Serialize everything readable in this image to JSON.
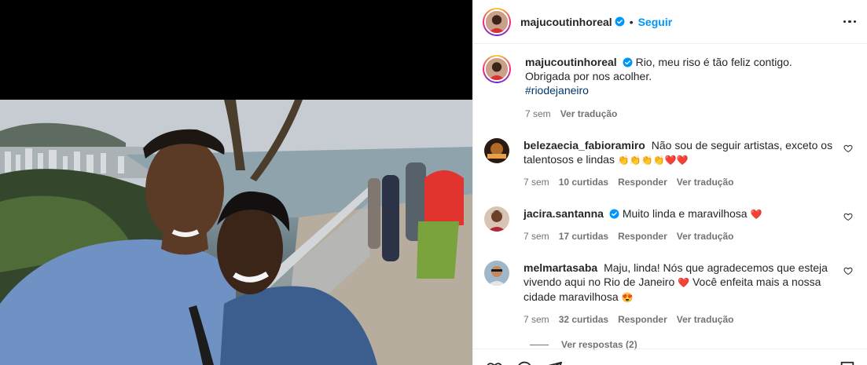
{
  "post": {
    "author": "majucoutinhoreal",
    "follow_label": "Seguir",
    "separator": "•"
  },
  "caption": {
    "author": "majucoutinhoreal",
    "line1": "Rio, meu riso é tão feliz contigo.",
    "line2": "Obrigada por nos acolher.",
    "hashtag": "#riodejaneiro",
    "time": "7 sem",
    "translate": "Ver tradução"
  },
  "comments": [
    {
      "author": "belezaecia_fabioramiro",
      "text": "Não sou de seguir artistas, exceto os talentosos e lindas",
      "emojis": "👏👏👏👏❤️❤️",
      "time": "7 sem",
      "likes": "10 curtidas",
      "reply": "Responder",
      "translate": "Ver tradução"
    },
    {
      "author": "jacira.santanna",
      "text": "Muito linda e maravilhosa",
      "emojis": "❤️",
      "time": "7 sem",
      "likes": "17 curtidas",
      "reply": "Responder",
      "translate": "Ver tradução"
    },
    {
      "author": "melmartasaba",
      "text_a": "Maju, linda! Nós que agradecemos que esteja vivendo aqui no Rio de Janeiro",
      "text_b": "Você enfeita mais a nossa cidade maravilhosa",
      "emoji_a": "❤️",
      "emoji_b": "😍",
      "time": "7 sem",
      "likes": "32 curtidas",
      "reply": "Responder",
      "translate": "Ver tradução",
      "replies": "Ver respostas (2)"
    }
  ],
  "icons": {
    "verified": "verified-badge-icon",
    "more": "more-options-icon",
    "like": "heart-icon",
    "comment": "comment-icon",
    "share": "share-icon",
    "save": "bookmark-icon"
  },
  "colors": {
    "link": "#0095f6",
    "hashtag": "#00376b",
    "muted": "#737373",
    "heart": "#ed4956"
  }
}
